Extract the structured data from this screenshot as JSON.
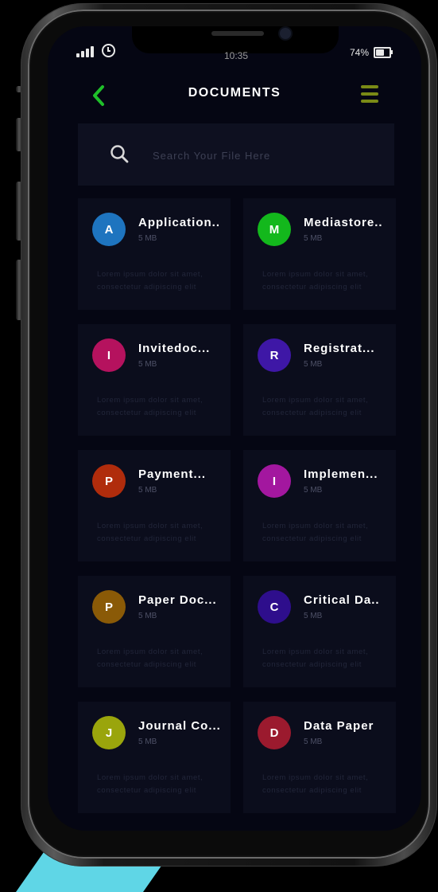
{
  "status_bar": {
    "time": "10:35",
    "battery": "74%",
    "battery_level": 0.74
  },
  "header": {
    "title": "DOCUMENTS",
    "back_icon": "back-arrow-icon",
    "menu_icon": "hamburger-menu-icon"
  },
  "search": {
    "placeholder": "Search Your File Here",
    "value": ""
  },
  "colors": {
    "accent_green": "#1fbf2a",
    "menu_olive": "#7a8a16",
    "background": "#050613",
    "card": "#0b0d1c"
  },
  "documents": [
    {
      "letter": "A",
      "name": "Application..",
      "size": "5 MB",
      "color": "#1e74bf",
      "description": "Lorem ipsum dolor sit amet, consectetur adipiscing elit"
    },
    {
      "letter": "M",
      "name": "Mediastore..",
      "size": "5 MB",
      "color": "#13b81c",
      "description": "Lorem ipsum dolor sit amet, consectetur adipiscing elit"
    },
    {
      "letter": "I",
      "name": "Invitedoc...",
      "size": "5 MB",
      "color": "#b5125e",
      "description": "Lorem ipsum dolor sit amet, consectetur adipiscing elit"
    },
    {
      "letter": "R",
      "name": "Registrat...",
      "size": "5 MB",
      "color": "#3e17a6",
      "description": "Lorem ipsum dolor sit amet, consectetur adipiscing elit"
    },
    {
      "letter": "P",
      "name": "Payment...",
      "size": "5 MB",
      "color": "#b02c0c",
      "description": "Lorem ipsum dolor sit amet, consectetur adipiscing elit"
    },
    {
      "letter": "I",
      "name": "Implemen...",
      "size": "5 MB",
      "color": "#a3179f",
      "description": "Lorem ipsum dolor sit amet, consectetur adipiscing elit"
    },
    {
      "letter": "P",
      "name": "Paper Doc...",
      "size": "5 MB",
      "color": "#8a5a07",
      "description": "Lorem ipsum dolor sit amet, consectetur adipiscing elit"
    },
    {
      "letter": "C",
      "name": "Critical Da..",
      "size": "5 MB",
      "color": "#2e0e8c",
      "description": "Lorem ipsum dolor sit amet, consectetur adipiscing elit"
    },
    {
      "letter": "J",
      "name": "Journal Co...",
      "size": "5 MB",
      "color": "#9aa50c",
      "description": "Lorem ipsum dolor sit amet, consectetur adipiscing elit"
    },
    {
      "letter": "D",
      "name": "Data Paper",
      "size": "5 MB",
      "color": "#9b1a2e",
      "description": "Lorem ipsum dolor sit amet, consectetur adipiscing elit"
    }
  ]
}
